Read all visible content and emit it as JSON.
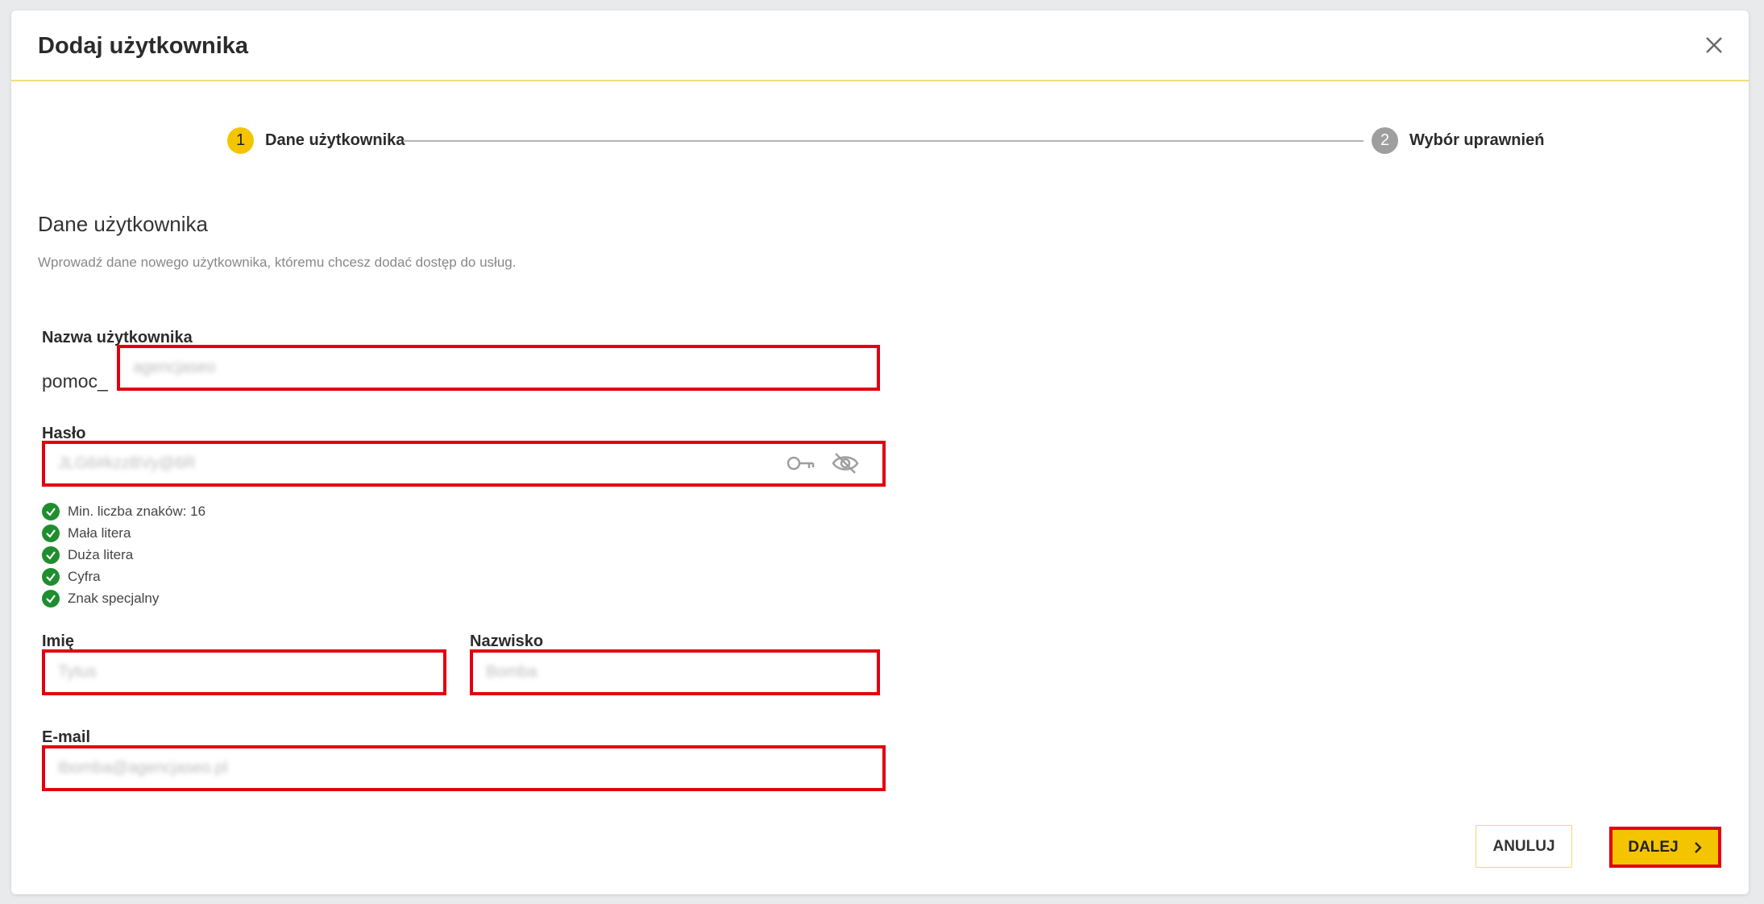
{
  "dialog": {
    "title": "Dodaj użytkownika",
    "close_icon": "close-icon"
  },
  "stepper": {
    "steps": [
      {
        "number": "1",
        "label": "Dane użytkownika",
        "state": "active"
      },
      {
        "number": "2",
        "label": "Wybór uprawnień",
        "state": "inactive"
      }
    ]
  },
  "section": {
    "title": "Dane użytkownika",
    "description": "Wprowadź dane nowego użytkownika, któremu chcesz dodać dostęp do usług."
  },
  "form": {
    "username": {
      "label": "Nazwa użytkownika",
      "prefix": "pomoc_",
      "value": "agencjaseo"
    },
    "password": {
      "label": "Hasło",
      "value": "JLG6#kzzBVy@6R",
      "generate_icon": "key-icon",
      "toggle_icon": "eye-off-icon",
      "requirements": [
        "Min. liczba znaków: 16",
        "Mała litera",
        "Duża litera",
        "Cyfra",
        "Znak specjalny"
      ]
    },
    "first_name": {
      "label": "Imię",
      "value": "Tytus"
    },
    "last_name": {
      "label": "Nazwisko",
      "value": "Bomba"
    },
    "email": {
      "label": "E-mail",
      "value": "tbomba@agencjaseo.pl"
    }
  },
  "actions": {
    "cancel_label": "ANULUJ",
    "next_label": "DALEJ",
    "next_icon": "chevron-right-icon"
  },
  "colors": {
    "accent": "#f5c400",
    "highlight": "#e2000f",
    "success": "#1e8e2e"
  }
}
